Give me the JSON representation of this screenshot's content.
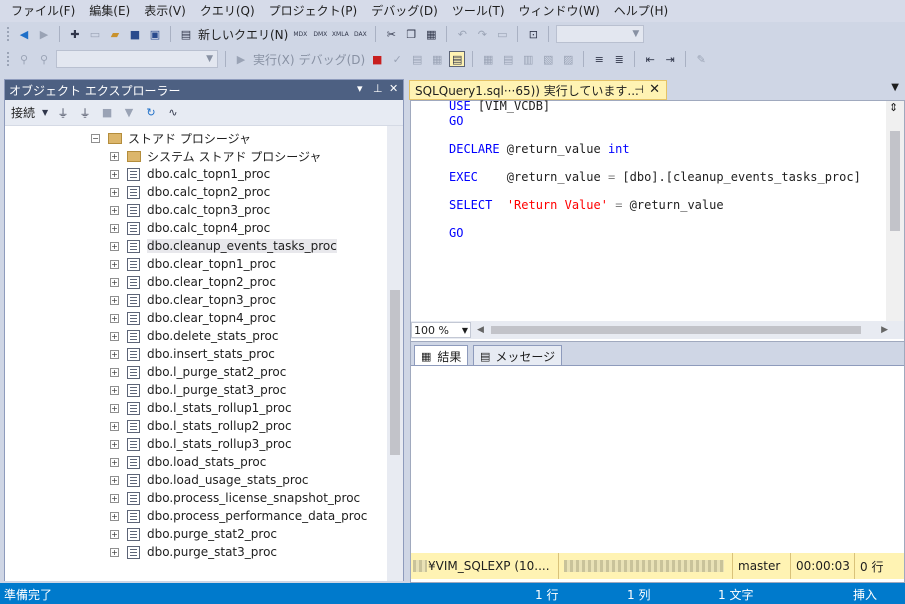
{
  "menu": [
    "ファイル(F)",
    "編集(E)",
    "表示(V)",
    "クエリ(Q)",
    "プロジェクト(P)",
    "デバッグ(D)",
    "ツール(T)",
    "ウィンドウ(W)",
    "ヘルプ(H)"
  ],
  "toolbar1": {
    "new_query_label": "新しいクエリ(N)",
    "mdx": "MDX",
    "dmx": "DMX",
    "xmla": "XMLA",
    "dax": "DAX"
  },
  "toolbar2": {
    "execute_label": "実行(X)",
    "debug_label": "デバッグ(D)"
  },
  "object_explorer": {
    "title": "オブジェクト エクスプローラー",
    "connect_label": "接続",
    "folder": "ストアド プロシージャ",
    "system_folder": "システム ストアド プロシージャ",
    "procedures": [
      "dbo.calc_topn1_proc",
      "dbo.calc_topn2_proc",
      "dbo.calc_topn3_proc",
      "dbo.calc_topn4_proc",
      "dbo.cleanup_events_tasks_proc",
      "dbo.clear_topn1_proc",
      "dbo.clear_topn2_proc",
      "dbo.clear_topn3_proc",
      "dbo.clear_topn4_proc",
      "dbo.delete_stats_proc",
      "dbo.insert_stats_proc",
      "dbo.l_purge_stat2_proc",
      "dbo.l_purge_stat3_proc",
      "dbo.l_stats_rollup1_proc",
      "dbo.l_stats_rollup2_proc",
      "dbo.l_stats_rollup3_proc",
      "dbo.load_stats_proc",
      "dbo.load_usage_stats_proc",
      "dbo.process_license_snapshot_proc",
      "dbo.process_performance_data_proc",
      "dbo.purge_stat2_proc",
      "dbo.purge_stat3_proc"
    ]
  },
  "editor": {
    "tab_title": "SQLQuery1.sql···65)) 実行しています...",
    "code": {
      "l1_kw": "USE",
      "l1_rest": " [VIM_VCDB]",
      "l2_kw": "GO",
      "l3_kw": "DECLARE",
      "l3_mid": " @return_value ",
      "l3_type": "int",
      "l4_kw": "EXEC",
      "l4_mid": "    @return_value ",
      "l4_eq": "=",
      "l4_rest": " [dbo].[cleanup_events_tasks_proc]",
      "l5_kw": "SELECT",
      "l5_sp": "  ",
      "l5_str": "'Return Value'",
      "l5_sp2": " ",
      "l5_eq": "=",
      "l5_rest": " @return_value",
      "l6_kw": "GO"
    },
    "zoom": "100 %",
    "results_tab": "結果",
    "messages_tab": "メッセージ",
    "status": {
      "server": "¥VIM_SQLEXP (10....",
      "database": "master",
      "elapsed": "00:00:03",
      "rows": "0 行"
    }
  },
  "statusbar": {
    "ready": "準備完了",
    "line": "1 行",
    "col": "1 列",
    "ch": "1 文字",
    "mode": "挿入"
  }
}
